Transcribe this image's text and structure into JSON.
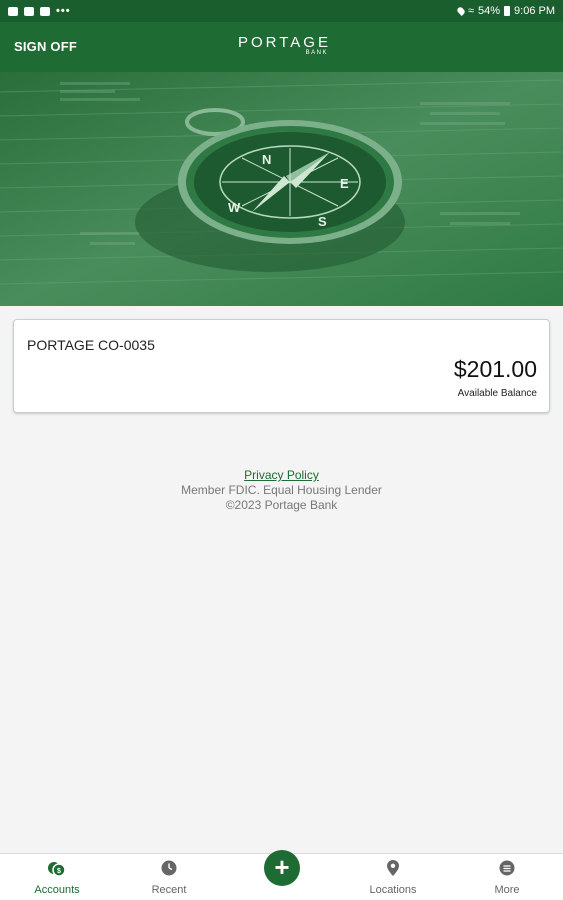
{
  "status_bar": {
    "battery": "54%",
    "time": "9:06 PM",
    "dots": "•••"
  },
  "header": {
    "sign_off_label": "SIGN OFF",
    "logo_text": "PORTAGE",
    "logo_sub": "BANK"
  },
  "accounts": [
    {
      "name": "PORTAGE CO-0035",
      "balance": "$201.00",
      "balance_label": "Available Balance"
    }
  ],
  "footer": {
    "privacy_label": "Privacy Policy",
    "fdic": "Member FDIC. Equal Housing Lender",
    "copyright": "©2023 Portage Bank"
  },
  "nav": {
    "accounts": "Accounts",
    "recent": "Recent",
    "add": "+",
    "locations": "Locations",
    "more": "More"
  },
  "colors": {
    "brand_green": "#1e6b33",
    "status_green": "#1b5e2e"
  }
}
